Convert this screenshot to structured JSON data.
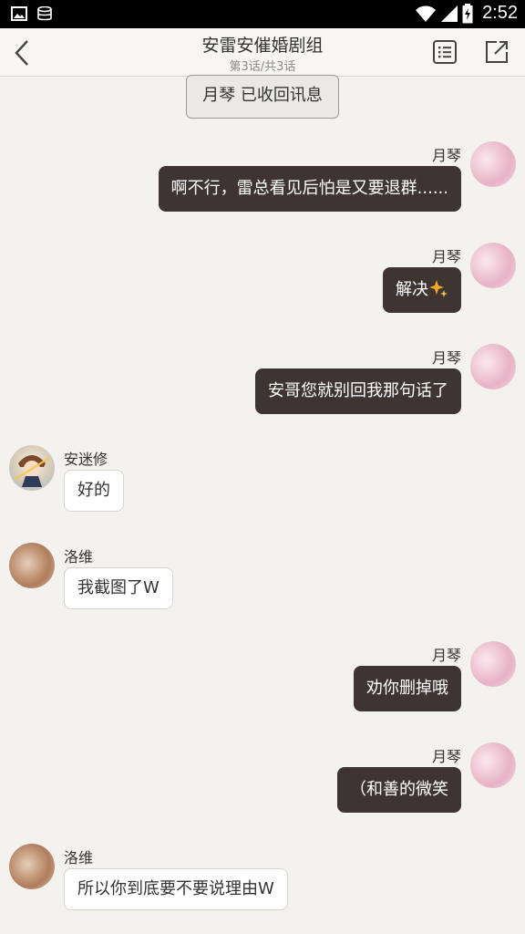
{
  "status_bar": {
    "time": "2:52",
    "icons": [
      "image-icon",
      "stack-icon",
      "wifi-icon",
      "signal-icon",
      "battery-icon"
    ]
  },
  "header": {
    "title": "安雷安催婚剧组",
    "subtitle": "第3话/共3话",
    "icons": [
      "back-icon",
      "list-icon",
      "share-icon"
    ]
  },
  "recall_notice": "月琴 已收回讯息",
  "colors": {
    "my_bubble": "#3e3533",
    "their_bubble": "#ffffff",
    "background": "#f4f2ee",
    "sparkle": "#f5a623"
  },
  "messages": [
    {
      "sender": "月琴",
      "side": "me",
      "text": "啊不行，雷总看见后怕是又要退群......"
    },
    {
      "sender": "月琴",
      "side": "me",
      "text": "解决",
      "emoji": "sparkles-icon"
    },
    {
      "sender": "月琴",
      "side": "me",
      "text": "安哥您就别回我那句话了"
    },
    {
      "sender": "安迷修",
      "side": "them",
      "text": "好的"
    },
    {
      "sender": "洛维",
      "side": "them",
      "text": "我截图了W"
    },
    {
      "sender": "月琴",
      "side": "me",
      "text": "劝你删掉哦"
    },
    {
      "sender": "月琴",
      "side": "me",
      "text": "（和善的微笑"
    },
    {
      "sender": "洛维",
      "side": "them",
      "text": "所以你到底要不要说理由W"
    }
  ]
}
